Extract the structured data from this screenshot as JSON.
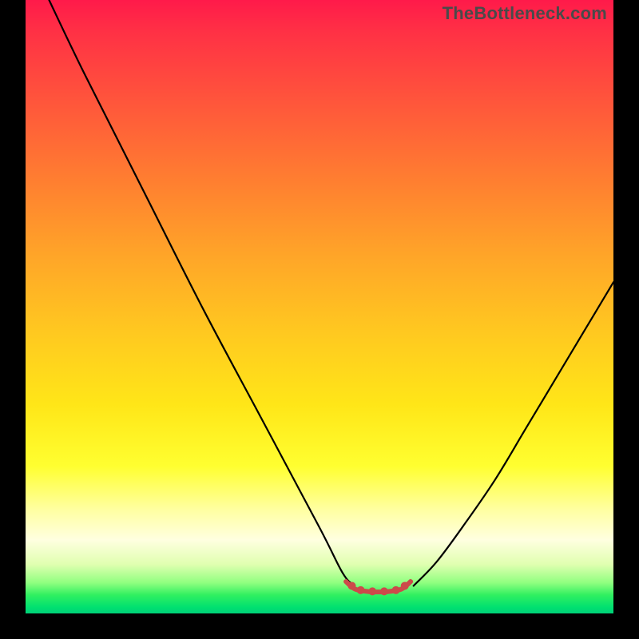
{
  "watermark": "TheBottleneck.com",
  "chart_data": {
    "type": "line",
    "title": "",
    "xlabel": "",
    "ylabel": "",
    "xlim": [
      0,
      100
    ],
    "ylim": [
      0,
      100
    ],
    "series": [
      {
        "name": "black-curve-left",
        "color": "#000000",
        "x": [
          4,
          10,
          20,
          30,
          40,
          50,
          54,
          56
        ],
        "values": [
          100,
          88,
          69,
          50,
          32,
          14,
          6.5,
          4.5
        ]
      },
      {
        "name": "black-curve-right",
        "color": "#000000",
        "x": [
          66,
          70,
          75,
          80,
          85,
          90,
          95,
          100
        ],
        "values": [
          4.5,
          8.5,
          15,
          22,
          30,
          38,
          46,
          54
        ]
      },
      {
        "name": "red-segment",
        "color": "#cc4a4a",
        "x": [
          54.5,
          56,
          58,
          60,
          62,
          64,
          65.5
        ],
        "values": [
          5.2,
          4.0,
          3.6,
          3.5,
          3.6,
          4.0,
          5.2
        ]
      }
    ],
    "red_dots": {
      "color": "#cc4a4a",
      "x": [
        55.5,
        57,
        59,
        61,
        63,
        64.5
      ],
      "values": [
        4.5,
        3.8,
        3.6,
        3.6,
        3.8,
        4.5
      ]
    }
  }
}
